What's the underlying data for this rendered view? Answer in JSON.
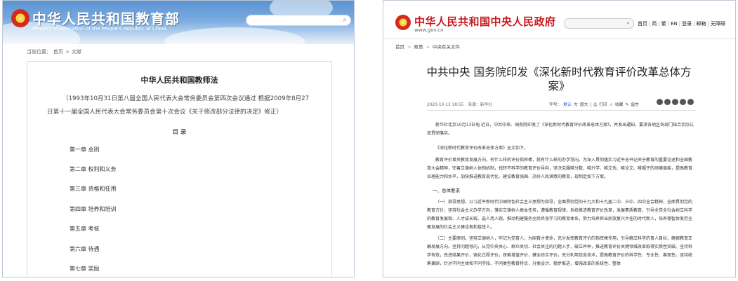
{
  "left": {
    "header": {
      "title": "中华人民共和国教育部",
      "subtitle": "Ministry of Education of the People's Republic of China"
    },
    "breadcrumb": [
      "当前位置：",
      "首页",
      ">",
      "文献"
    ],
    "doc": {
      "title": "中华人民共和国教师法",
      "note": "（1993年10月31日第八届全国人民代表大会常务委员会第四次会议通过 根据2009年8月27日第十一届全国人民代表大会常务委员会第十次会议《关于修改部分法律的决定》修正）",
      "toc_title": "目 录",
      "toc": [
        "第一章 总则",
        "第二章 权利和义务",
        "第三章 资格和任用",
        "第四章 培养和培训",
        "第五章 考核",
        "第六章 待遇",
        "第七章 奖励"
      ]
    }
  },
  "right": {
    "header": {
      "title": "中华人民共和国中央人民政府",
      "url": "www.gov.cn",
      "nav": [
        "首页",
        "简",
        "繁",
        "EN",
        "登录",
        "邮箱",
        "无障碍"
      ]
    },
    "breadcrumb": [
      "首页",
      ">",
      "政策",
      ">",
      "中央有关文件"
    ],
    "article": {
      "title": "中共中央 国务院印发《深化新时代教育评价改革总体方案》",
      "date": "2020-10-13 18:55",
      "source": "来源：新华社",
      "font_label": "字号：",
      "font_sizes": [
        "默认",
        "大",
        "超大"
      ],
      "actions": [
        "打印",
        "收藏",
        "留言"
      ],
      "paragraphs": [
        "新华社北京10月13日电 近日，中共中央、国务院印发了《深化新时代教育评价改革总体方案》，并发出通知，要求各地区各部门结合实际认真贯彻落实。",
        "《深化新时代教育评价改革总体方案》全文如下。",
        "教育评价事关教育发展方向，有什么样的评价指挥棒，就有什么样的办学导向。为深入贯彻落实习近平总书记关于教育的重要论述和全国教育大会精神，完善立德树人体制机制，扭转不科学的教育评价导向，坚决克服唯分数、唯升学、唯文凭、唯论文、唯帽子的顽瘴痼疾，提高教育治理能力和水平，加快推进教育现代化、建设教育强国、办好人民满意的教育，现制定如下方案。"
      ],
      "section1": "一、总体要求",
      "paragraphs2": [
        "（一）指导思想。以习近平新时代中国特色社会主义思想为指导，全面贯彻党的十九大和十九届二中、三中、四中全会精神，全面贯彻党的教育方针，坚持社会主义办学方向，落实立德树人根本任务，遵循教育规律，系统推进教育评价改革，发展素质教育，引导全党全社会树立科学的教育发展观、人才成长观、选人用人观，推动构建服务全民终身学习的教育体系，努力培养担当民族复兴大任的时代新人，培养德智体美劳全面发展的社会主义建设者和接班人。",
        "（二）主要原则。坚持立德树人，牢记为党育人、为国育才使命，充分发挥教育评价的指挥棒作用，引导确立科学的育人目标，确保教育正确发展方向。坚持问题导向，从党中央关心、群众关切、社会关注的问题入手，破立并举，推进教育评价关键领域改革取得实质性突破。坚持科学有效，改进结果评价，强化过程评价，探索增值评价，健全综合评价，充分利用信息技术，提高教育评价的科学性、专业性、客观性。坚持统筹兼顾，针对不同主体和不同学段、不同类型教育特点，分类设计、稳步推进，增强改革的系统性、整体"
      ]
    }
  },
  "colors": {
    "gov_red": "#c9161d",
    "moe_blue": "#5b93d3",
    "link_blue": "#1a56b5"
  }
}
